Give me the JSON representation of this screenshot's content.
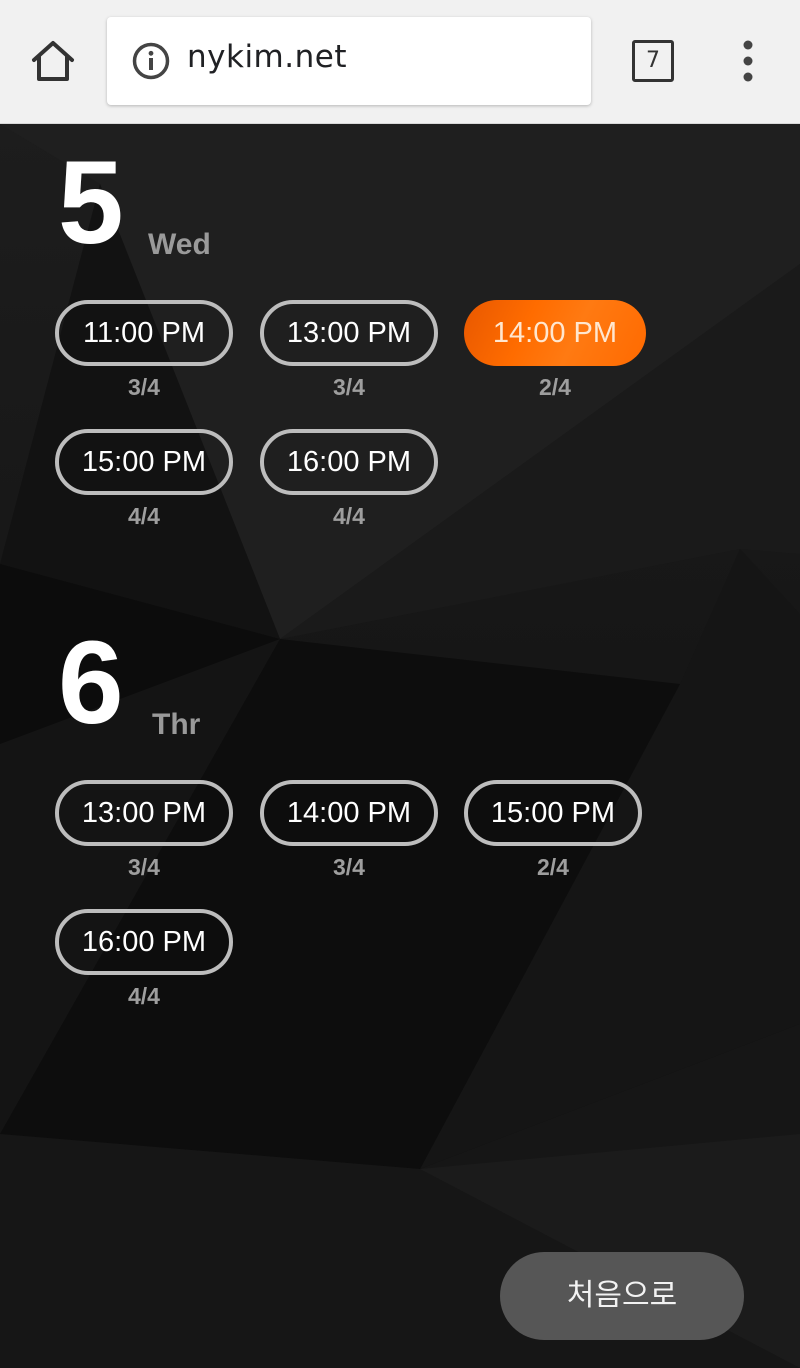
{
  "browser": {
    "url": "nykim.net",
    "tab_count": "7"
  },
  "days": [
    {
      "number": "5",
      "weekday": "Wed",
      "slots": [
        {
          "time": "11:00 PM",
          "count": "3/4",
          "selected": false
        },
        {
          "time": "13:00 PM",
          "count": "3/4",
          "selected": false
        },
        {
          "time": "14:00 PM",
          "count": "2/4",
          "selected": true
        },
        {
          "time": "15:00 PM",
          "count": "4/4",
          "selected": false
        },
        {
          "time": "16:00 PM",
          "count": "4/4",
          "selected": false
        }
      ]
    },
    {
      "number": "6",
      "weekday": "Thr",
      "slots": [
        {
          "time": "13:00 PM",
          "count": "3/4",
          "selected": false
        },
        {
          "time": "14:00 PM",
          "count": "3/4",
          "selected": false
        },
        {
          "time": "15:00 PM",
          "count": "2/4",
          "selected": false
        },
        {
          "time": "16:00 PM",
          "count": "4/4",
          "selected": false
        }
      ]
    }
  ],
  "back_button_label": "처음으로",
  "colors": {
    "accent": "#ff6c00",
    "slot_border": "#bdbdbd",
    "count_text": "#9e9e9e"
  },
  "icons": {
    "home": "home-icon",
    "info": "info-icon",
    "tabs": "tab-switcher-icon",
    "menu": "more-vert-icon"
  }
}
